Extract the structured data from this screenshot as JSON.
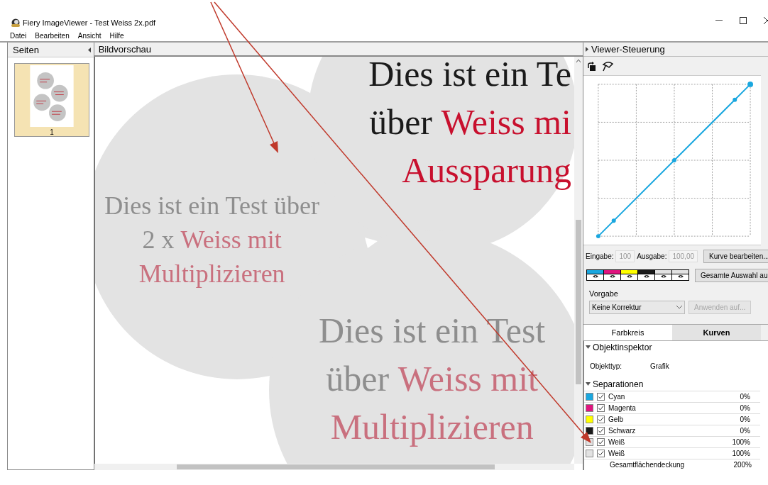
{
  "window": {
    "title": "Fiery ImageViewer - Test Weiss 2x.pdf"
  },
  "menu": [
    {
      "label": "Datei"
    },
    {
      "label": "Bearbeiten"
    },
    {
      "label": "Ansicht"
    },
    {
      "label": "Hilfe"
    }
  ],
  "pages_pane": {
    "title": "Seiten",
    "thumbnails": [
      {
        "label": "1",
        "selected": true
      }
    ]
  },
  "preview": {
    "title": "Bildvorschau",
    "text_blocks": [
      {
        "kind": "strong",
        "lines": [
          [
            {
              "text": "Dies ist ein Te",
              "accent": false
            }
          ],
          [
            {
              "text": "über ",
              "accent": false
            },
            {
              "text": "Weiss mi",
              "accent": true
            }
          ],
          [
            {
              "text": "Aussparung",
              "accent": true
            }
          ]
        ]
      },
      {
        "kind": "faded",
        "lines": [
          [
            {
              "text": "Dies ist ein Test über",
              "accent": false
            }
          ],
          [
            {
              "text": "2 x ",
              "accent": false
            },
            {
              "text": "Weiss mit",
              "accent": true
            }
          ],
          [
            {
              "text": "Multiplizieren",
              "accent": true
            }
          ]
        ]
      },
      {
        "kind": "faded",
        "lines": [
          [
            {
              "text": "Dies ist ein Test",
              "accent": false
            }
          ],
          [
            {
              "text": "über ",
              "accent": false
            },
            {
              "text": "Weiss mit",
              "accent": true
            }
          ],
          [
            {
              "text": "Multiplizieren",
              "accent": true
            }
          ]
        ]
      }
    ]
  },
  "viewer": {
    "title": "Viewer-Steuerung",
    "input_label": "Eingabe:",
    "input_value": "100",
    "output_label": "Ausgabe:",
    "output_value": "100,00",
    "edit_curve_button": "Kurve bearbeiten...",
    "channels": [
      {
        "color": "#1aa7df"
      },
      {
        "color": "#e0157f"
      },
      {
        "color": "#ffff00"
      },
      {
        "color": "#1a1a1a"
      },
      {
        "color": "#e2e2e2"
      },
      {
        "color": "#e2e2e2"
      }
    ],
    "select_all_button": "Gesamte Auswahl au",
    "preset_label": "Vorgabe",
    "preset_value": "Keine Korrektur",
    "apply_button": {
      "label": "Anwenden auf...",
      "disabled": true
    },
    "tabs": [
      {
        "label": "Farbkreis",
        "selected": false
      },
      {
        "label": "Kurven",
        "selected": true
      }
    ]
  },
  "inspector": {
    "title": "Objektinspektor",
    "expanded": true,
    "object_type_label": "Objekttyp:",
    "object_type": "Grafik"
  },
  "separations": {
    "title": "Separationen",
    "expanded": true,
    "rows": [
      {
        "color": "#1aa7df",
        "checked": true,
        "name": "Cyan",
        "value": "0%"
      },
      {
        "color": "#e0157f",
        "checked": true,
        "name": "Magenta",
        "value": "0%"
      },
      {
        "color": "#ffff00",
        "checked": true,
        "name": "Gelb",
        "value": "0%"
      },
      {
        "color": "#1a1a1a",
        "checked": true,
        "name": "Schwarz",
        "value": "0%"
      },
      {
        "color": "#e2e2e2",
        "checked": true,
        "name": "Weiß",
        "value": "100%"
      },
      {
        "color": "#e2e2e2",
        "checked": true,
        "name": "Weiß",
        "value": "100%"
      }
    ],
    "total_label": "Gesamtflächendeckung",
    "total_value": "200%"
  }
}
